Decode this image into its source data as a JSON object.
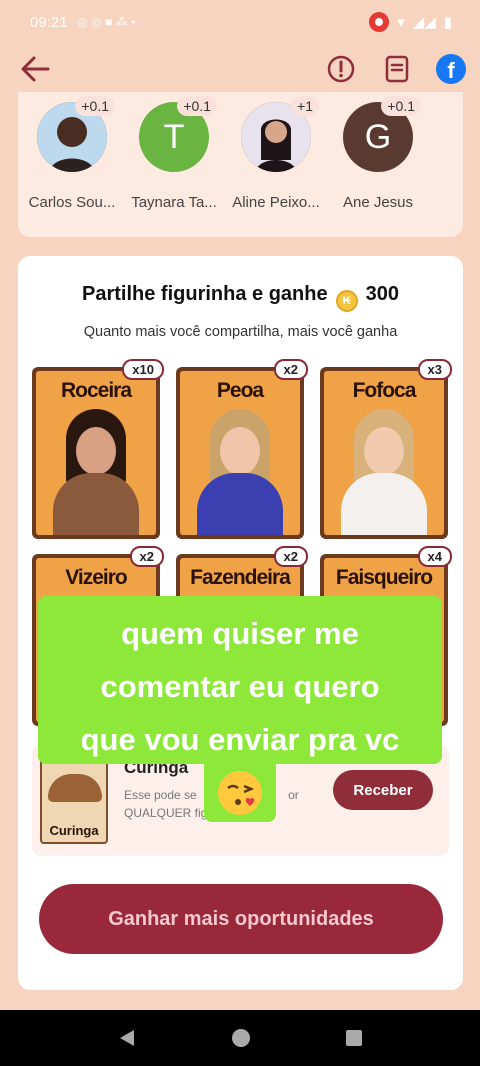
{
  "status": {
    "time": "09:21"
  },
  "colors": {
    "accent": "#98283a",
    "highlight": "#8ee83a",
    "bg": "#f7d4bf"
  },
  "friends": [
    {
      "name": "Carlos Sou...",
      "badge": "+0.1",
      "initial": "",
      "avatar_color": "#2b2220"
    },
    {
      "name": "Taynara Ta...",
      "badge": "+0.1",
      "initial": "T",
      "avatar_color": "#6ab541"
    },
    {
      "name": "Aline Peixo...",
      "badge": "+1",
      "initial": "",
      "avatar_color": "#3a2a2c"
    },
    {
      "name": "Ane Jesus",
      "badge": "+0.1",
      "initial": "G",
      "avatar_color": "#5a3a30"
    }
  ],
  "share": {
    "title": "Partilhe figurinha e ganhe",
    "amount": "300",
    "subtitle": "Quanto mais você compartilha, mais você ganha"
  },
  "stickers": [
    {
      "name": "Roceira",
      "mult": "x10"
    },
    {
      "name": "Peoa",
      "mult": "x2"
    },
    {
      "name": "Fofoca",
      "mult": "x3"
    },
    {
      "name": "Vizeiro",
      "mult": "x2"
    },
    {
      "name": "Fazendeira",
      "mult": "x2"
    },
    {
      "name": "Faisqueiro",
      "mult": "x4"
    }
  ],
  "wildcard": {
    "title": "Curinga",
    "image_label": "Curinga",
    "desc_line1": "Esse pode se",
    "desc_line1_end": "or",
    "desc_line2": "QUALQUER figurinha!",
    "button": "Receber"
  },
  "more_button": "Ganhar mais oportunidades",
  "overlay": {
    "line1": "quem quiser me",
    "line2": "comentar eu quero",
    "line3": "que vou enviar pra vc"
  }
}
